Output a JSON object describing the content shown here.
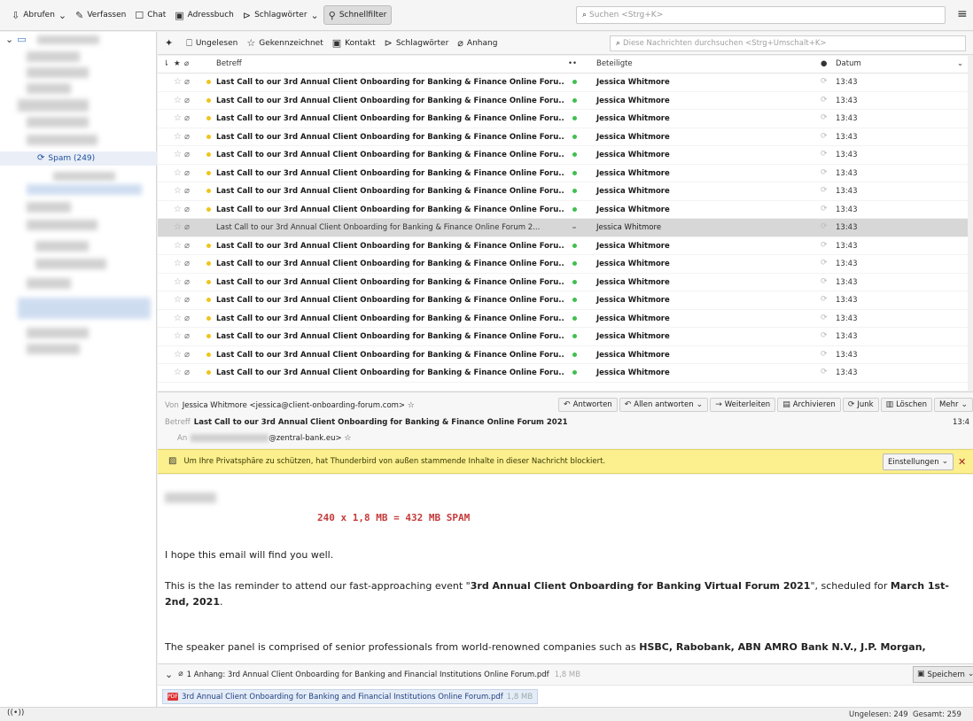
{
  "toolbar": {
    "get_messages": "Abrufen",
    "compose": "Verfassen",
    "chat": "Chat",
    "address_book": "Adressbuch",
    "tags": "Schlagwörter",
    "quick_filter": "Schnellfilter",
    "search_placeholder": "Suchen <Strg+K>"
  },
  "folders": {
    "spam_label": "Spam (249)"
  },
  "quick_filter_bar": {
    "unread": "Ungelesen",
    "starred": "Gekennzeichnet",
    "contact": "Kontakt",
    "tags": "Schlagwörter",
    "attachment": "Anhang",
    "search_placeholder": "Diese Nachrichten durchsuchen <Strg+Umschalt+K>"
  },
  "thread_columns": {
    "subject": "Betreff",
    "participants": "Beteiligte",
    "date": "Datum"
  },
  "messages": {
    "subject_short": "Last Call to our 3rd Annual Client Onboarding for Banking & Finance Online Foru...",
    "subject_selected": "Last Call to our 3rd Annual Client Onboarding for Banking & Finance Online Forum 2...",
    "from": "Jessica Whitmore",
    "time": "13:43"
  },
  "header": {
    "from_label": "Von",
    "from_value": "Jessica Whitmore <jessica@client-onboarding-forum.com>",
    "subject_label": "Betreff",
    "subject_value": "Last Call to our 3rd Annual Client Onboarding for Banking & Finance Online Forum 2021",
    "to_label": "An",
    "to_value": "@zentral-bank.eu>",
    "time": "13:4",
    "actions": {
      "reply": "Antworten",
      "reply_all": "Allen antworten",
      "forward": "Weiterleiten",
      "archive": "Archivieren",
      "junk": "Junk",
      "delete": "Löschen",
      "more": "Mehr"
    }
  },
  "notice": {
    "text": "Um Ihre Privatsphäre zu schützen, hat Thunderbird von außen stammende Inhalte in dieser Nachricht blockiert.",
    "settings": "Einstellungen"
  },
  "body": {
    "spam_note": "240 x 1,8 MB = 432 MB SPAM",
    "p1": "I hope this email will find you well.",
    "p2_a": "This is the las reminder to attend our fast-approaching event \"",
    "p2_bold": "3rd Annual Client Onboarding for Banking Virtual Forum 2021",
    "p2_b": "\", scheduled for ",
    "p2_date": "March 1st-2nd, 2021",
    "p2_end": ".",
    "p3_a": "The speaker panel is comprised of senior professionals from world-renowned companies such as ",
    "p3_bold": "HSBC, Rabobank, ABN AMRO Bank N.V., J.P. Morgan,"
  },
  "attachments": {
    "summary": "1 Anhang: 3rd Annual Client Onboarding for Banking and Financial Institutions Online Forum.pdf",
    "size": "1,8 MB",
    "save": "Speichern",
    "file_name": "3rd Annual Client Onboarding for Banking and Financial Institutions Online Forum.pdf",
    "file_size": "1,8 MB"
  },
  "status": {
    "unread": "Ungelesen: 249",
    "total": "Gesamt: 259"
  }
}
